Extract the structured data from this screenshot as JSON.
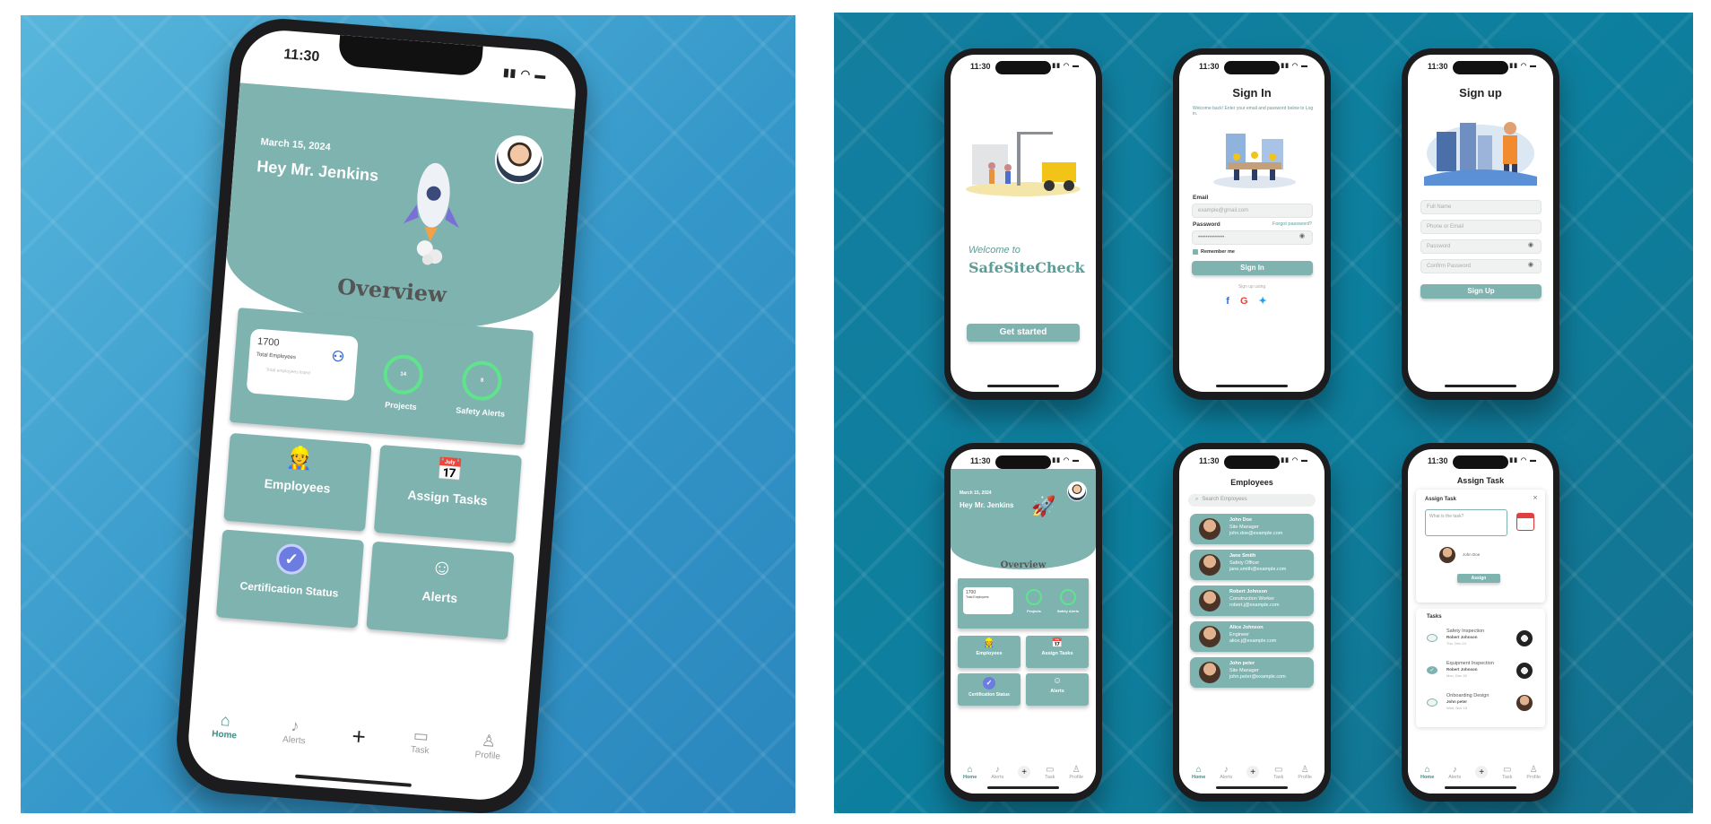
{
  "home_big": {
    "time": "11:30",
    "date": "March 15, 2024",
    "greeting": "Hey Mr. Jenkins",
    "overview": "Overview",
    "total_value": "1700",
    "total_label": "Total Employees",
    "total_sub": "Total employees listed",
    "projects_value": "14",
    "projects_label": "Projects",
    "alerts_value": "8",
    "alerts_label": "Safety Alerts",
    "cards": [
      "Employees",
      "Assign Tasks",
      "Certification Status",
      "Alerts"
    ],
    "tabs": [
      "Home",
      "Alerts",
      "+",
      "Task",
      "Profile"
    ]
  },
  "welcome": {
    "time": "11:30",
    "welcome": "Welcome to",
    "app": "SafeSiteCheck",
    "button": "Get started"
  },
  "signin": {
    "time": "11:30",
    "title": "Sign In",
    "subtitle": "Welcome back! Enter your email and password below to Log in.",
    "email_label": "Email",
    "email_placeholder": "example@gmail.com",
    "password_label": "Password",
    "forgot": "Forgot password?",
    "password_value": "••••••••••••••",
    "remember": "Remember me",
    "button": "Sign In",
    "or": "Sign up using"
  },
  "signup": {
    "time": "11:30",
    "title": "Sign up",
    "fields": [
      "Full Name",
      "Phone or Email",
      "Password",
      "Confirm Password"
    ],
    "button": "Sign Up"
  },
  "home_small": {
    "time": "11:30",
    "date": "March 15, 2024",
    "greeting": "Hey Mr. Jenkins",
    "overview": "Overview",
    "total_value": "1700",
    "total_label": "Total Employees",
    "projects_label": "Projects",
    "alerts_label": "Safety Alerts",
    "cards": [
      "Employees",
      "Assign Tasks",
      "Certification Status",
      "Alerts"
    ],
    "tabs": [
      "Home",
      "Alerts",
      "+",
      "Task",
      "Profile"
    ]
  },
  "employees": {
    "time": "11:30",
    "title": "Employees",
    "search_placeholder": "Search Employees",
    "list": [
      {
        "name": "John Doe",
        "role": "Site Manager",
        "email": "john.doe@example.com"
      },
      {
        "name": "Jane Smith",
        "role": "Safety Officer",
        "email": "jane.smith@example.com"
      },
      {
        "name": "Robert Johnson",
        "role": "Construction Worker",
        "email": "robert.j@example.com"
      },
      {
        "name": "Alice Johnson",
        "role": "Engineer",
        "email": "alice.j@example.com"
      },
      {
        "name": "John peter",
        "role": "Site Manager",
        "email": "john.peter@example.com"
      }
    ],
    "tabs": [
      "Home",
      "Alerts",
      "+",
      "Task",
      "Profile"
    ]
  },
  "assign": {
    "time": "11:30",
    "title": "Assign Task",
    "card_title": "Assign Task",
    "placeholder": "What is the task?",
    "assignee": "John Doe",
    "button": "Assign",
    "tasks_heading": "Tasks",
    "tasks": [
      {
        "title": "Safety Inspection",
        "person": "Robert Johnson",
        "date": "Thu, Dec 24",
        "done": false
      },
      {
        "title": "Equipment Inspection",
        "person": "Robert Johnson",
        "date": "Mon, Dec 15",
        "done": true
      },
      {
        "title": "Onboarding Design",
        "person": "John peter",
        "date": "Wed, Nov 15",
        "done": false
      }
    ],
    "tabs": [
      "Home",
      "Alerts",
      "+",
      "Task",
      "Profile"
    ]
  }
}
